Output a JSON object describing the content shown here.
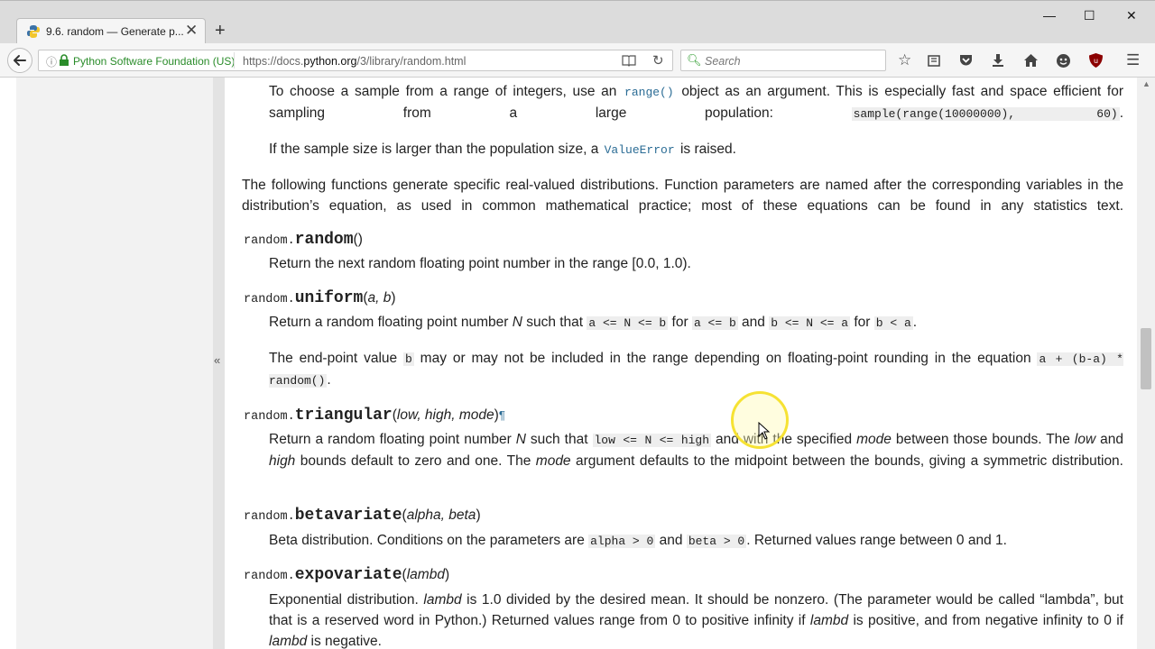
{
  "browser": {
    "tab_title": "9.6. random — Generate p...",
    "tab_close": "✕",
    "new_tab": "+",
    "window_controls": {
      "minimize": "—",
      "maximize": "☐",
      "close": "✕"
    },
    "site_identity": "Python Software Foundation (US)",
    "url_prefix": "https://docs.",
    "url_domain": "python.org",
    "url_path": "/3/library/random.html",
    "search_placeholder": "Search",
    "sidebar_toggle": "«"
  },
  "doc": {
    "sample_p1": [
      "To choose a sample from a range of integers, use an ",
      "range()",
      " object as an argument. This is especially fast and space efficient for sampling from a large population: ",
      "sample(range(10000000), 60)",
      "."
    ],
    "sample_p2": [
      "If the sample size is larger than the population size, a ",
      "ValueError",
      " is raised."
    ],
    "intro": "The following functions generate specific real-valued distributions. Function parameters are named after the corresponding variables in the distribution’s equation, as used in common mathematical practice; most of these equations can be found in any statistics text.",
    "functions": [
      {
        "module": "random.",
        "name": "random",
        "params": "",
        "desc": "Return the next random floating point number in the range [0.0, 1.0)."
      },
      {
        "module": "random.",
        "name": "uniform",
        "params": "a, b",
        "desc1": [
          "Return a random floating point number ",
          "N",
          " such that ",
          "a <= N <= b",
          " for ",
          "a <= b",
          " and ",
          "b <= N <= a",
          " for ",
          "b < a",
          "."
        ],
        "desc2": [
          "The end-point value ",
          "b",
          " may or may not be included in the range depending on floating-point rounding in the equation ",
          "a + (b-a) * random()",
          "."
        ]
      },
      {
        "module": "random.",
        "name": "triangular",
        "params": "low, high, mode",
        "pilcrow": "¶",
        "desc": [
          "Return a random floating point number ",
          "N",
          " such that ",
          "low <= N <= high",
          " and with the specified ",
          "mode",
          " between those bounds. The ",
          "low",
          " and ",
          "high",
          " bounds default to zero and one. The ",
          "mode",
          " argument defaults to the midpoint between the bounds, giving a symmetric distribution."
        ]
      },
      {
        "module": "random.",
        "name": "betavariate",
        "params": "alpha, beta",
        "desc": [
          "Beta distribution. Conditions on the parameters are ",
          "alpha > 0",
          " and ",
          "beta > 0",
          ". Returned values range between 0 and 1."
        ]
      },
      {
        "module": "random.",
        "name": "expovariate",
        "params": "lambd",
        "desc": [
          "Exponential distribution. ",
          "lambd",
          " is 1.0 divided by the desired mean. It should be nonzero. (The parameter would be called “lambda”, but that is a reserved word in Python.) Returned values range from 0 to positive infinity if ",
          "lambd",
          " is positive, and from negative infinity to 0 if ",
          "lambd",
          " is negative."
        ]
      }
    ]
  }
}
